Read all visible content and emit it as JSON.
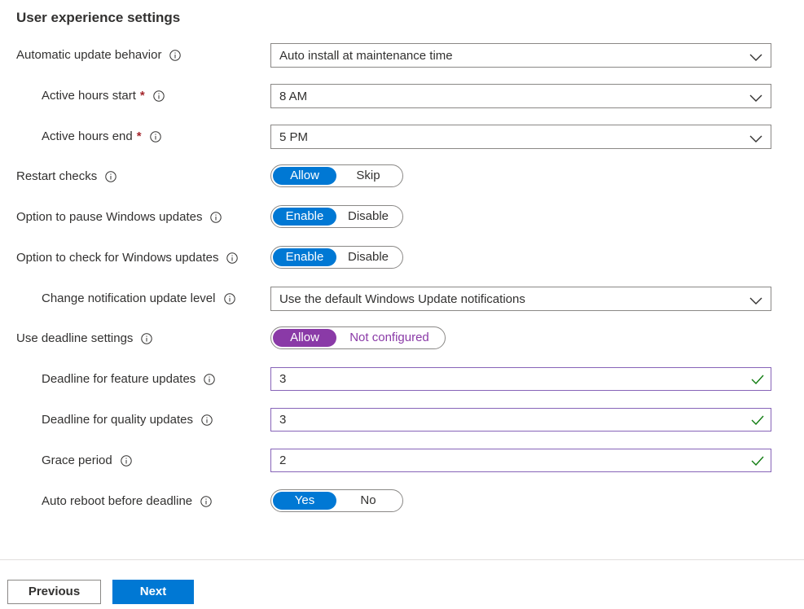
{
  "section": {
    "title": "User experience settings"
  },
  "settings": {
    "auto_update": {
      "label": "Automatic update behavior",
      "value": "Auto install at maintenance time"
    },
    "active_start": {
      "label": "Active hours start",
      "required": "*",
      "value": "8 AM"
    },
    "active_end": {
      "label": "Active hours end",
      "required": "*",
      "value": "5 PM"
    },
    "restart_checks": {
      "label": "Restart checks",
      "option_on": "Allow",
      "option_off": "Skip"
    },
    "pause_updates": {
      "label": "Option to pause Windows updates",
      "option_on": "Enable",
      "option_off": "Disable"
    },
    "check_updates": {
      "label": "Option to check for Windows updates",
      "option_on": "Enable",
      "option_off": "Disable"
    },
    "notification_level": {
      "label": "Change notification update level",
      "value": "Use the default Windows Update notifications"
    },
    "deadline_settings": {
      "label": "Use deadline settings",
      "option_on": "Allow",
      "option_off": "Not configured"
    },
    "deadline_feature": {
      "label": "Deadline for feature updates",
      "value": "3"
    },
    "deadline_quality": {
      "label": "Deadline for quality updates",
      "value": "3"
    },
    "grace_period": {
      "label": "Grace period",
      "value": "2"
    },
    "auto_reboot": {
      "label": "Auto reboot before deadline",
      "option_on": "Yes",
      "option_off": "No"
    }
  },
  "footer": {
    "previous_label": "Previous",
    "next_label": "Next"
  },
  "colors": {
    "accent": "#0078d4",
    "purple": "#8a3aa7",
    "valid": "#107c10",
    "required": "#a4262c"
  }
}
